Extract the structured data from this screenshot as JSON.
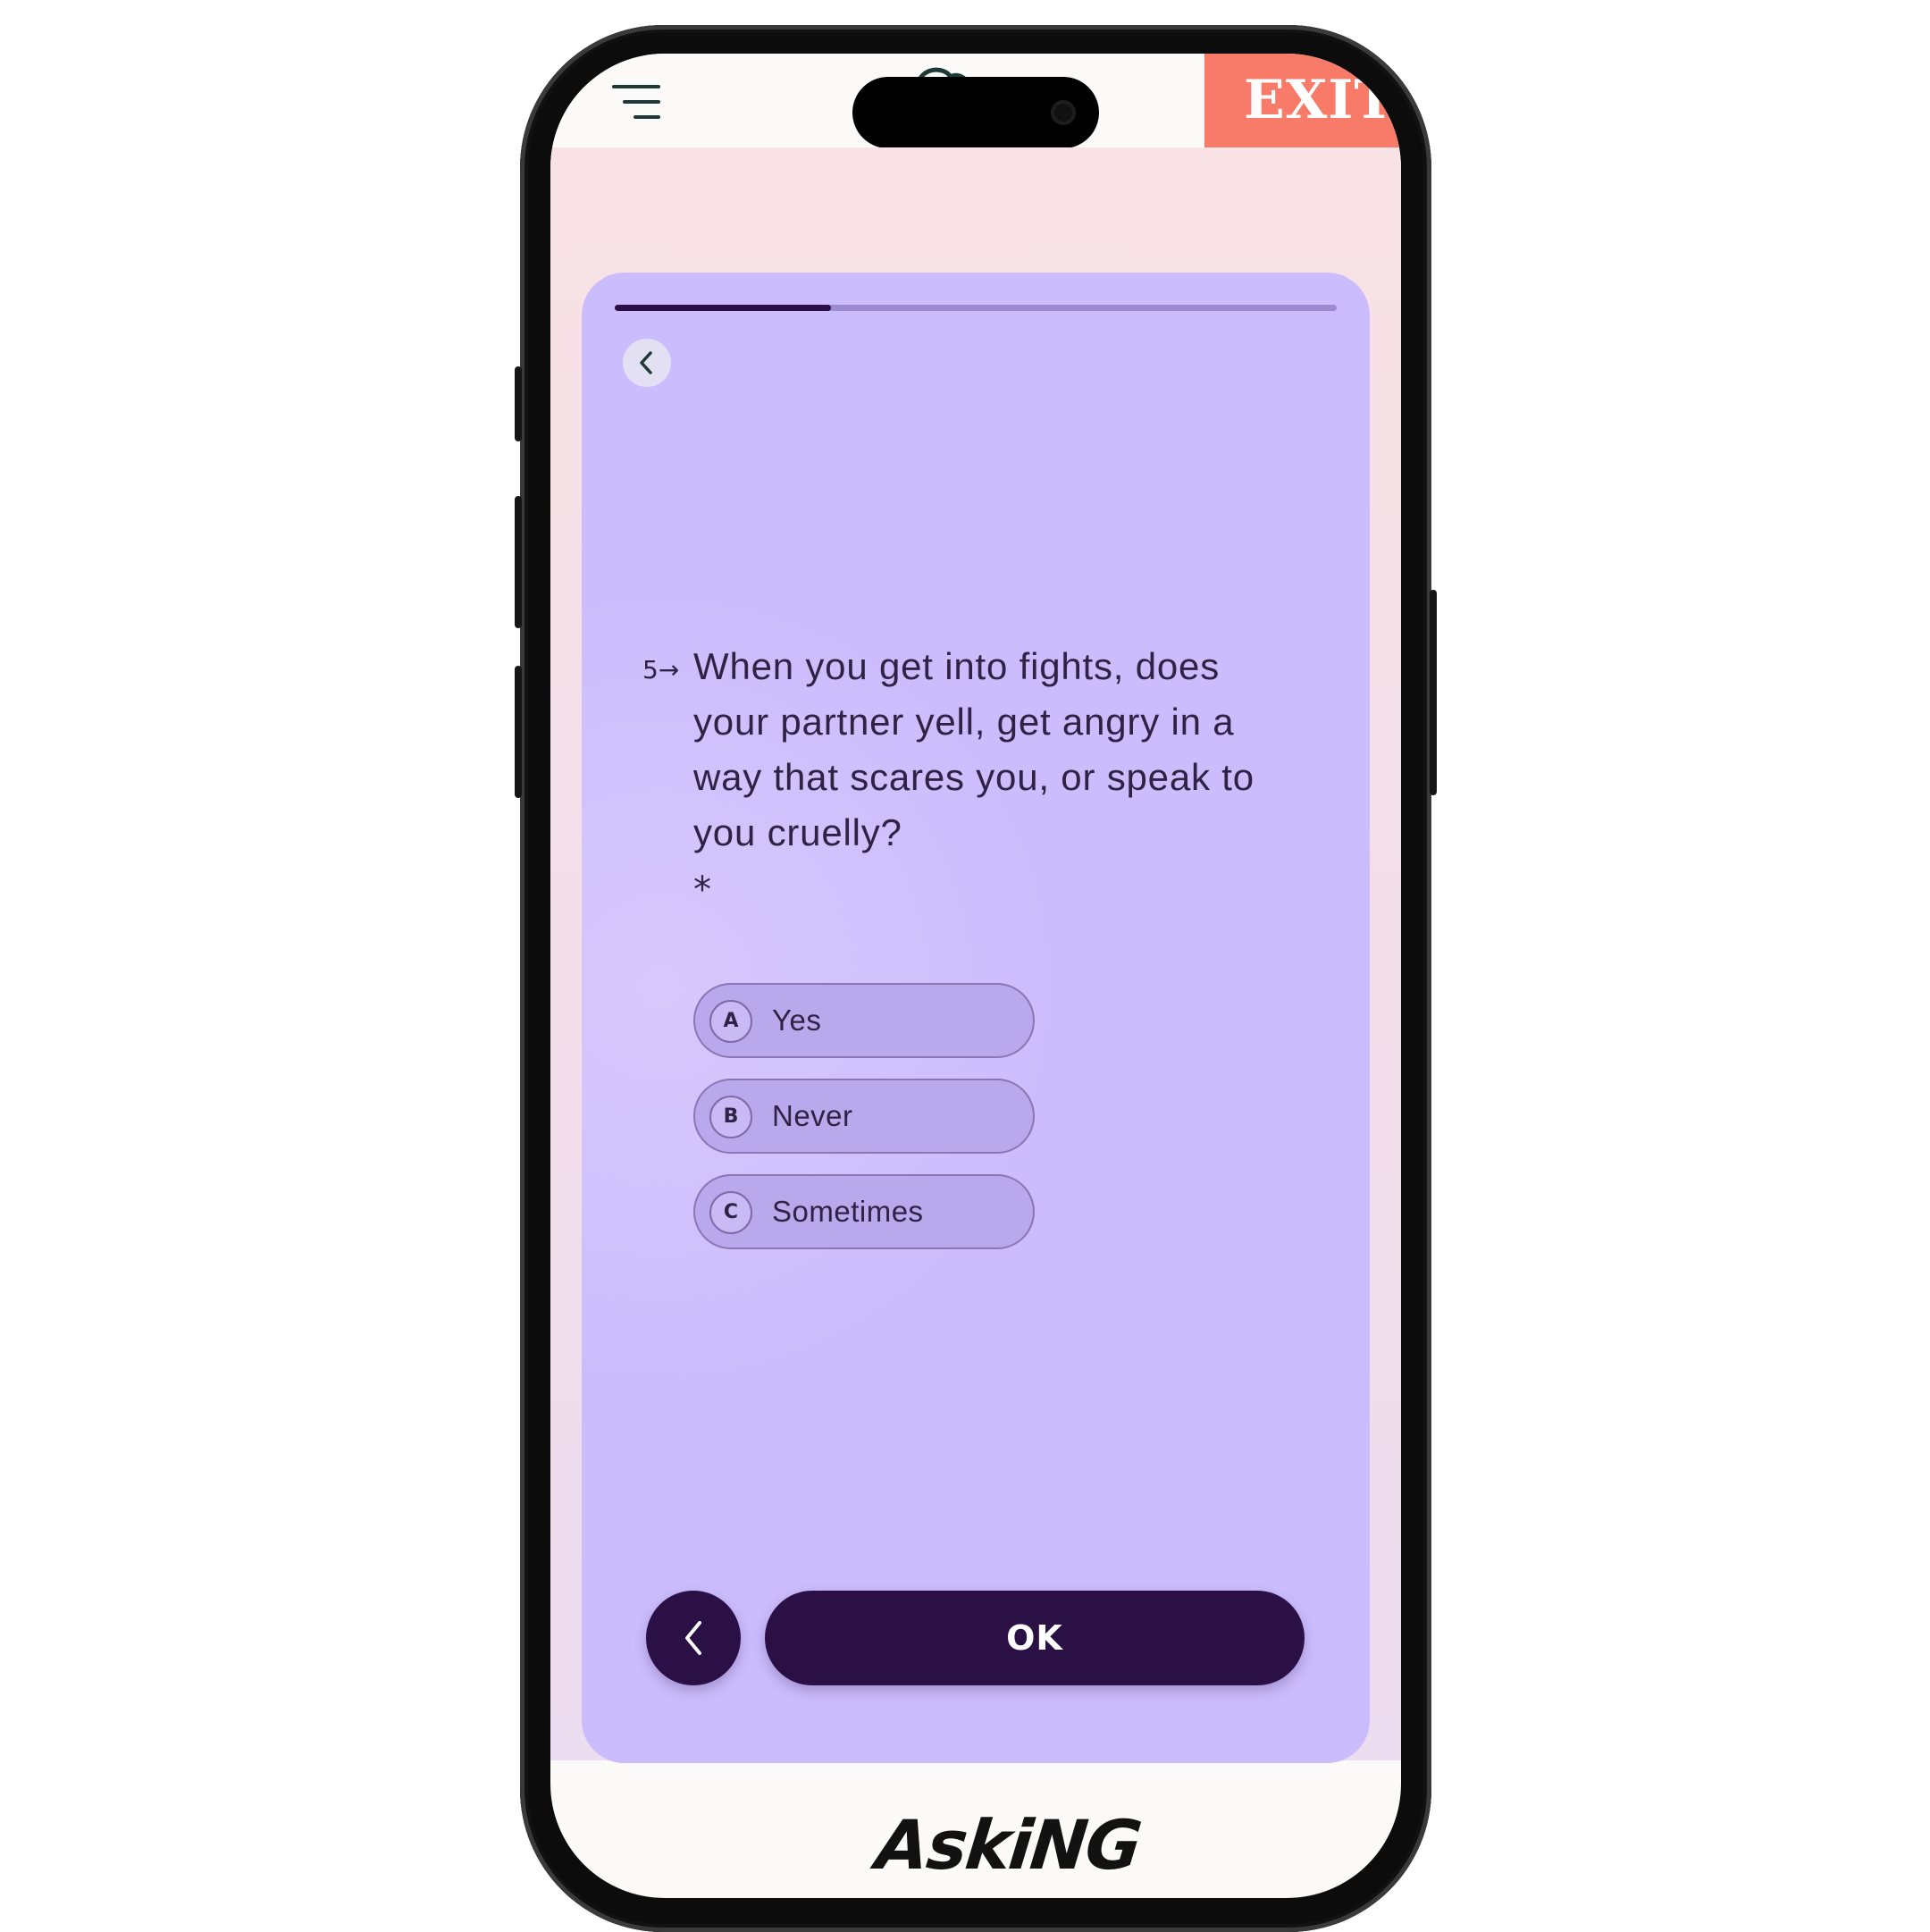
{
  "header": {
    "exit_label": "EXIT"
  },
  "quiz": {
    "progress": 0.3,
    "question_number": "5→",
    "question_text": "When you get into fights, does your partner yell, get angry in a way that scares you, or speak to you cruelly?",
    "required_marker": "*",
    "options": [
      {
        "key": "A",
        "label": "Yes"
      },
      {
        "key": "B",
        "label": "Never"
      },
      {
        "key": "C",
        "label": "Sometimes"
      }
    ],
    "ok_label": "OK"
  },
  "footer": {
    "logo_text": "AskiNG"
  },
  "colors": {
    "exit_bg": "#f87a68",
    "card_bg": "#cbbdfd",
    "dark_purple": "#2b1046"
  }
}
